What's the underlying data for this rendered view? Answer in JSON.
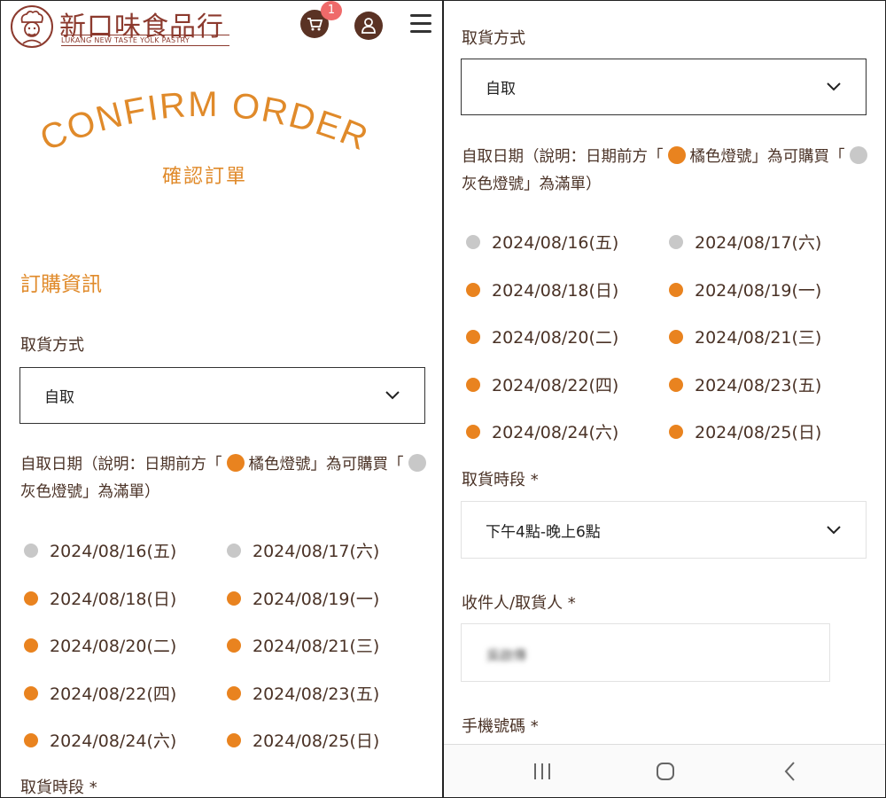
{
  "brand": {
    "name": "新口味食品行",
    "subname": "LUKANG NEW TASTE YOLK PASTRY",
    "logo_icon": "chef-logo-icon"
  },
  "header": {
    "cart_icon": "cart-icon",
    "cart_count": "1",
    "user_icon": "user-icon",
    "menu_icon": "hamburger-menu-icon"
  },
  "page": {
    "title": "CONFIRM ORDER",
    "subtitle": "確認訂單",
    "section_title": "訂購資訊"
  },
  "form": {
    "pickup_method_label": "取貨方式",
    "pickup_method_value": "自取",
    "date_note_pre": "自取日期（說明：日期前方「",
    "date_note_orange": "橘色燈號」為可購買「",
    "date_note_gray": "灰色燈號」為滿單）",
    "dates": [
      {
        "text": "2024/08/16(五)",
        "available": false
      },
      {
        "text": "2024/08/17(六)",
        "available": false
      },
      {
        "text": "2024/08/18(日)",
        "available": true
      },
      {
        "text": "2024/08/19(一)",
        "available": true
      },
      {
        "text": "2024/08/20(二)",
        "available": true
      },
      {
        "text": "2024/08/21(三)",
        "available": true
      },
      {
        "text": "2024/08/22(四)",
        "available": true
      },
      {
        "text": "2024/08/23(五)",
        "available": true
      },
      {
        "text": "2024/08/24(六)",
        "available": true
      },
      {
        "text": "2024/08/25(日)",
        "available": true
      }
    ],
    "time_slot_label": "取貨時段 *",
    "time_slot_value": "下午4點-晚上6點",
    "recipient_label": "收件人/取貨人 *",
    "recipient_value": "吳啟傳",
    "phone_label": "手機號碼 *"
  },
  "nav": {
    "recent_icon": "recent-apps-icon",
    "home_icon": "home-icon",
    "back_icon": "back-icon"
  },
  "colors": {
    "accent": "#e08a2a",
    "brand": "#8c3a2e",
    "available": "#e9831f",
    "full": "#c8c8c8",
    "badge": "#ef6a6a"
  }
}
